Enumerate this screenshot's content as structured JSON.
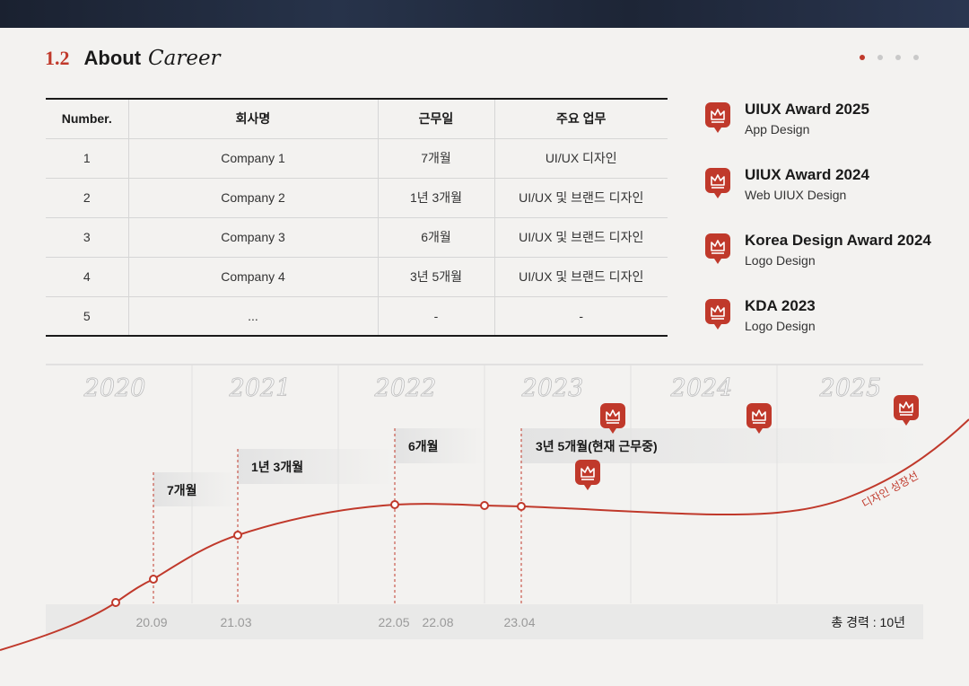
{
  "section": {
    "number": "1.2",
    "title": "About",
    "script": "Career"
  },
  "pagination": {
    "total": 4,
    "active": 0
  },
  "table": {
    "headers": [
      "Number.",
      "회사명",
      "근무일",
      "주요 업무"
    ],
    "rows": [
      [
        "1",
        "Company 1",
        "7개월",
        "UI/UX 디자인"
      ],
      [
        "2",
        "Company 2",
        "1년 3개월",
        "UI/UX 및 브랜드 디자인"
      ],
      [
        "3",
        "Company 3",
        "6개월",
        "UI/UX 및 브랜드 디자인"
      ],
      [
        "4",
        "Company 4",
        "3년 5개월",
        "UI/UX 및 브랜드 디자인"
      ],
      [
        "5",
        "...",
        "-",
        "-"
      ]
    ]
  },
  "awards": [
    {
      "title": "UIUX Award 2025",
      "sub": "App Design",
      "icon": "crown-icon"
    },
    {
      "title": "UIUX Award 2024",
      "sub": "Web UIUX Design",
      "icon": "crown-icon"
    },
    {
      "title": "Korea Design Award 2024",
      "sub": "Logo Design",
      "icon": "crown-icon"
    },
    {
      "title": "KDA 2023",
      "sub": "Logo Design",
      "icon": "crown-icon"
    }
  ],
  "timeline": {
    "years": [
      "2020",
      "2021",
      "2022",
      "2023",
      "2024",
      "2025"
    ],
    "periods": [
      "7개월",
      "1년 3개월",
      "6개월",
      "3년 5개월(현재 근무중)"
    ],
    "dates": [
      "20.09",
      "21.03",
      "22.05",
      "22.08",
      "23.04"
    ],
    "growth_label": "디자인 성장선",
    "total": "총 경력 : 10년"
  },
  "colors": {
    "accent": "#c0392b",
    "text": "#1a1a1a",
    "background": "#f3f2f0"
  }
}
